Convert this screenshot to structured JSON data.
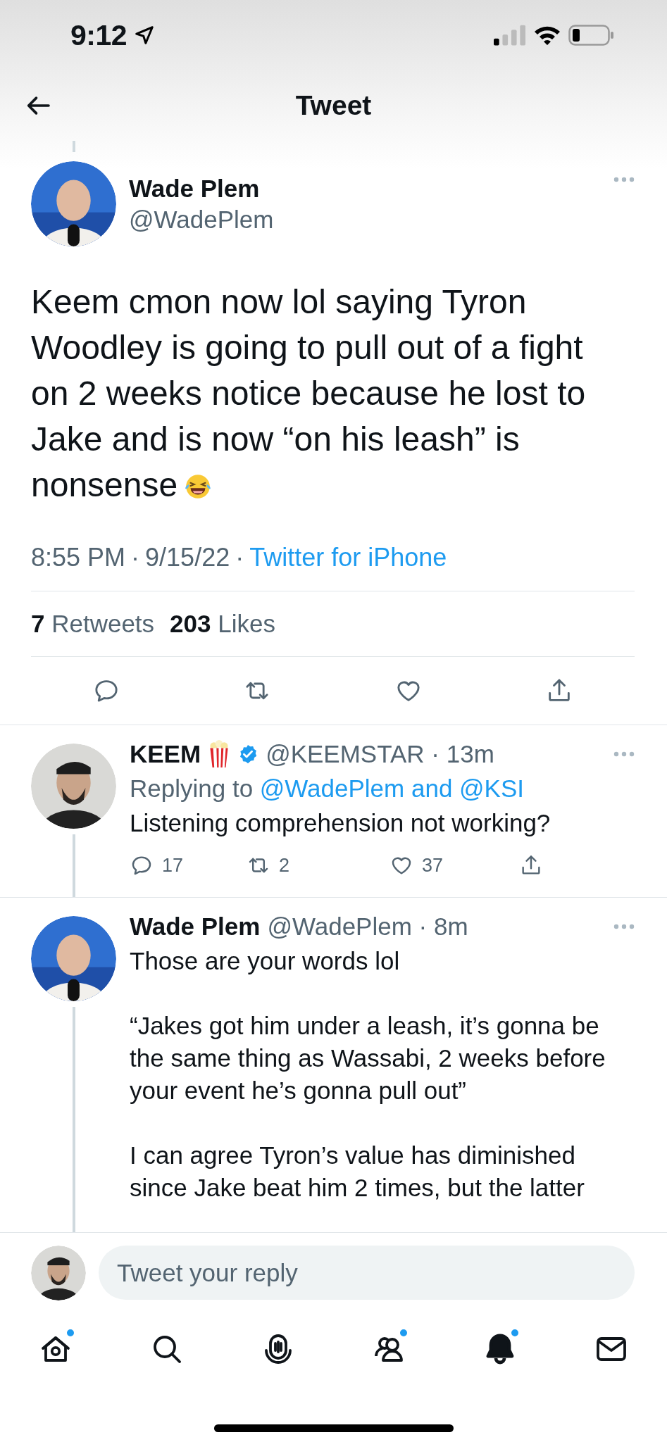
{
  "status_bar": {
    "time": "9:12"
  },
  "header": {
    "title": "Tweet"
  },
  "tweet": {
    "name": "Wade Plem",
    "handle": "@WadePlem",
    "text": "Keem cmon now lol saying Tyron Woodley is going to pull out of a fight on 2 weeks notice because he lost to Jake and is now “on his leash” is nonsense",
    "emoji": {
      "kind": "laughing"
    },
    "meta": [
      {
        "text": "8:55 PM",
        "kind": "plain"
      },
      {
        "text": "·",
        "kind": "plain"
      },
      {
        "text": "9/15/22",
        "kind": "plain"
      },
      {
        "text": "·",
        "kind": "plain"
      },
      {
        "text": "Twitter for iPhone",
        "kind": "link"
      }
    ],
    "stats": [
      {
        "count": "7",
        "label": "Retweets"
      },
      {
        "count": "203",
        "label": "Likes"
      }
    ],
    "actions": [
      {
        "kind": "reply"
      },
      {
        "kind": "retweet"
      },
      {
        "kind": "like"
      },
      {
        "kind": "share"
      }
    ]
  },
  "replies": [
    {
      "name": "KEEM",
      "name_emoji": {
        "kind": "popcorn"
      },
      "verified": true,
      "handle": "@KEEMSTAR · 13m",
      "replying_prefix": "Replying to",
      "replying_users": "@WadePlem and @KSI",
      "thread_below": true,
      "paragraphs": [
        "Listening comprehension not working?"
      ],
      "actions": [
        {
          "kind": "reply",
          "count": "17"
        },
        {
          "kind": "retweet",
          "count": "2"
        },
        {
          "kind": "like",
          "count": "37"
        },
        {
          "kind": "share"
        }
      ]
    },
    {
      "name": "Wade Plem",
      "verified": false,
      "handle": "@WadePlem · 8m",
      "thread_below": true,
      "paragraphs": [
        "Those are your words lol",
        "“Jakes got him under a leash, it’s gonna be the same thing as Wassabi, 2 weeks before your event he’s gonna pull out”",
        "I can agree Tyron’s value has diminished since Jake beat him 2 times, but the latter"
      ]
    }
  ],
  "composer": {
    "placeholder": "Tweet your reply"
  },
  "tabs": [
    {
      "kind": "home",
      "selected": false,
      "badge": true
    },
    {
      "kind": "search",
      "selected": false,
      "badge": false
    },
    {
      "kind": "spaces",
      "selected": false,
      "badge": false
    },
    {
      "kind": "communities",
      "selected": false,
      "badge": true
    },
    {
      "kind": "notifications",
      "selected": true,
      "badge": true
    },
    {
      "kind": "messages",
      "selected": false,
      "badge": false
    }
  ]
}
